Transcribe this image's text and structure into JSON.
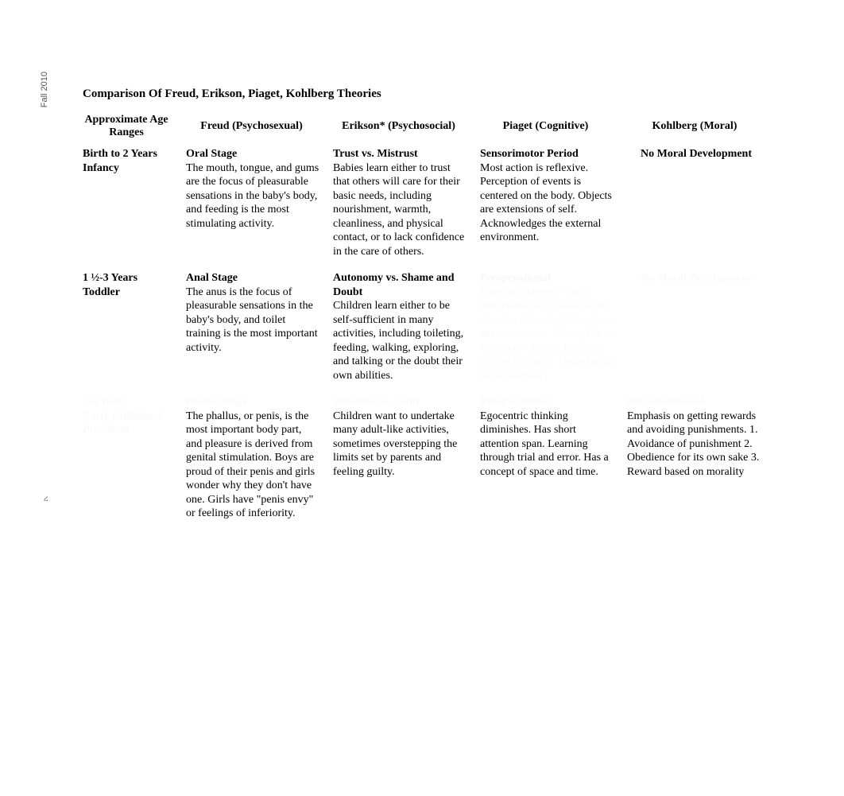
{
  "sideText": "Fall 2010",
  "pageMark": "ረ",
  "title": "Comparison Of Freud, Erikson, Piaget, Kohlberg Theories",
  "headers": {
    "age": "Approximate Age Ranges",
    "freud": "Freud (Psychosexual)",
    "erikson": "Erikson* (Psychosocial)",
    "piaget": "Piaget (Cognitive)",
    "kohlberg": "Kohlberg (Moral)"
  },
  "rows": [
    {
      "age_line1": "Birth to 2 Years",
      "age_line2": "Infancy",
      "freud_title": "Oral Stage",
      "freud_desc": "The mouth, tongue, and gums are the focus of pleasurable sensations in the baby's body, and feeding is the most stimulating activity.",
      "erikson_title": "Trust vs. Mistrust",
      "erikson_desc": "Babies learn either to trust that others will care for their basic needs, including nourishment, warmth, cleanliness, and physical contact, or to lack confidence in the care of others.",
      "piaget_title": "Sensorimotor Period",
      "piaget_desc": "Most action is reflexive. Perception of events is centered on the body. Objects are extensions of self. Acknowledges the external environment.",
      "kohlberg_center": "No Moral Development",
      "fadeClass": ""
    },
    {
      "age_line1": "1 ½-3 Years",
      "age_line2": "Toddler",
      "freud_title": "Anal Stage",
      "freud_desc": "The anus is the focus of pleasurable sensations in the baby's body, and toilet training is the most important activity.",
      "erikson_title": "Autonomy vs. Shame and Doubt",
      "erikson_desc": "Children learn either to be self-sufficient in many activities, including toileting, feeding, walking, exploring, and talking or the doubt their own abilities.",
      "piaget_title": "Preoperational",
      "piaget_desc": "Uses only senses—can't understand all. Thinks of one idea at a time. Includes others in environment. Giving life to inanimate objects. Explores the environment. Understands words literally.",
      "kohlberg_center": "No Moral Development",
      "piaget_fade": "faded1",
      "kohlberg_fade": "faded1"
    },
    {
      "age_line1": "3-6 Years",
      "age_line2": "Early Childhood-Preschool",
      "freud_title": "Phallic Stage",
      "freud_desc": "The phallus, or penis, is the most important body part, and pleasure is derived from genital stimulation. Boys are proud of their penis and girls wonder why they don't have one. Girls have \"penis envy\" or feelings of inferiority.",
      "erikson_title": "Initiative vs. Guilt",
      "erikson_desc": "Children want to undertake many adult-like activities, sometimes overstepping the limits set by parents and feeling guilty.",
      "piaget_title": "Preoperational",
      "piaget_desc": "Egocentric thinking diminishes. Has short attention span. Learning through trial and error. Has a concept of space and time.",
      "kohlberg_title": "Preconventional",
      "kohlberg_desc": "Emphasis on getting rewards and avoiding punishments. 1. Avoidance of punishment 2. Obedience for its own sake 3. Reward based on morality",
      "allFade": "faded2"
    }
  ]
}
